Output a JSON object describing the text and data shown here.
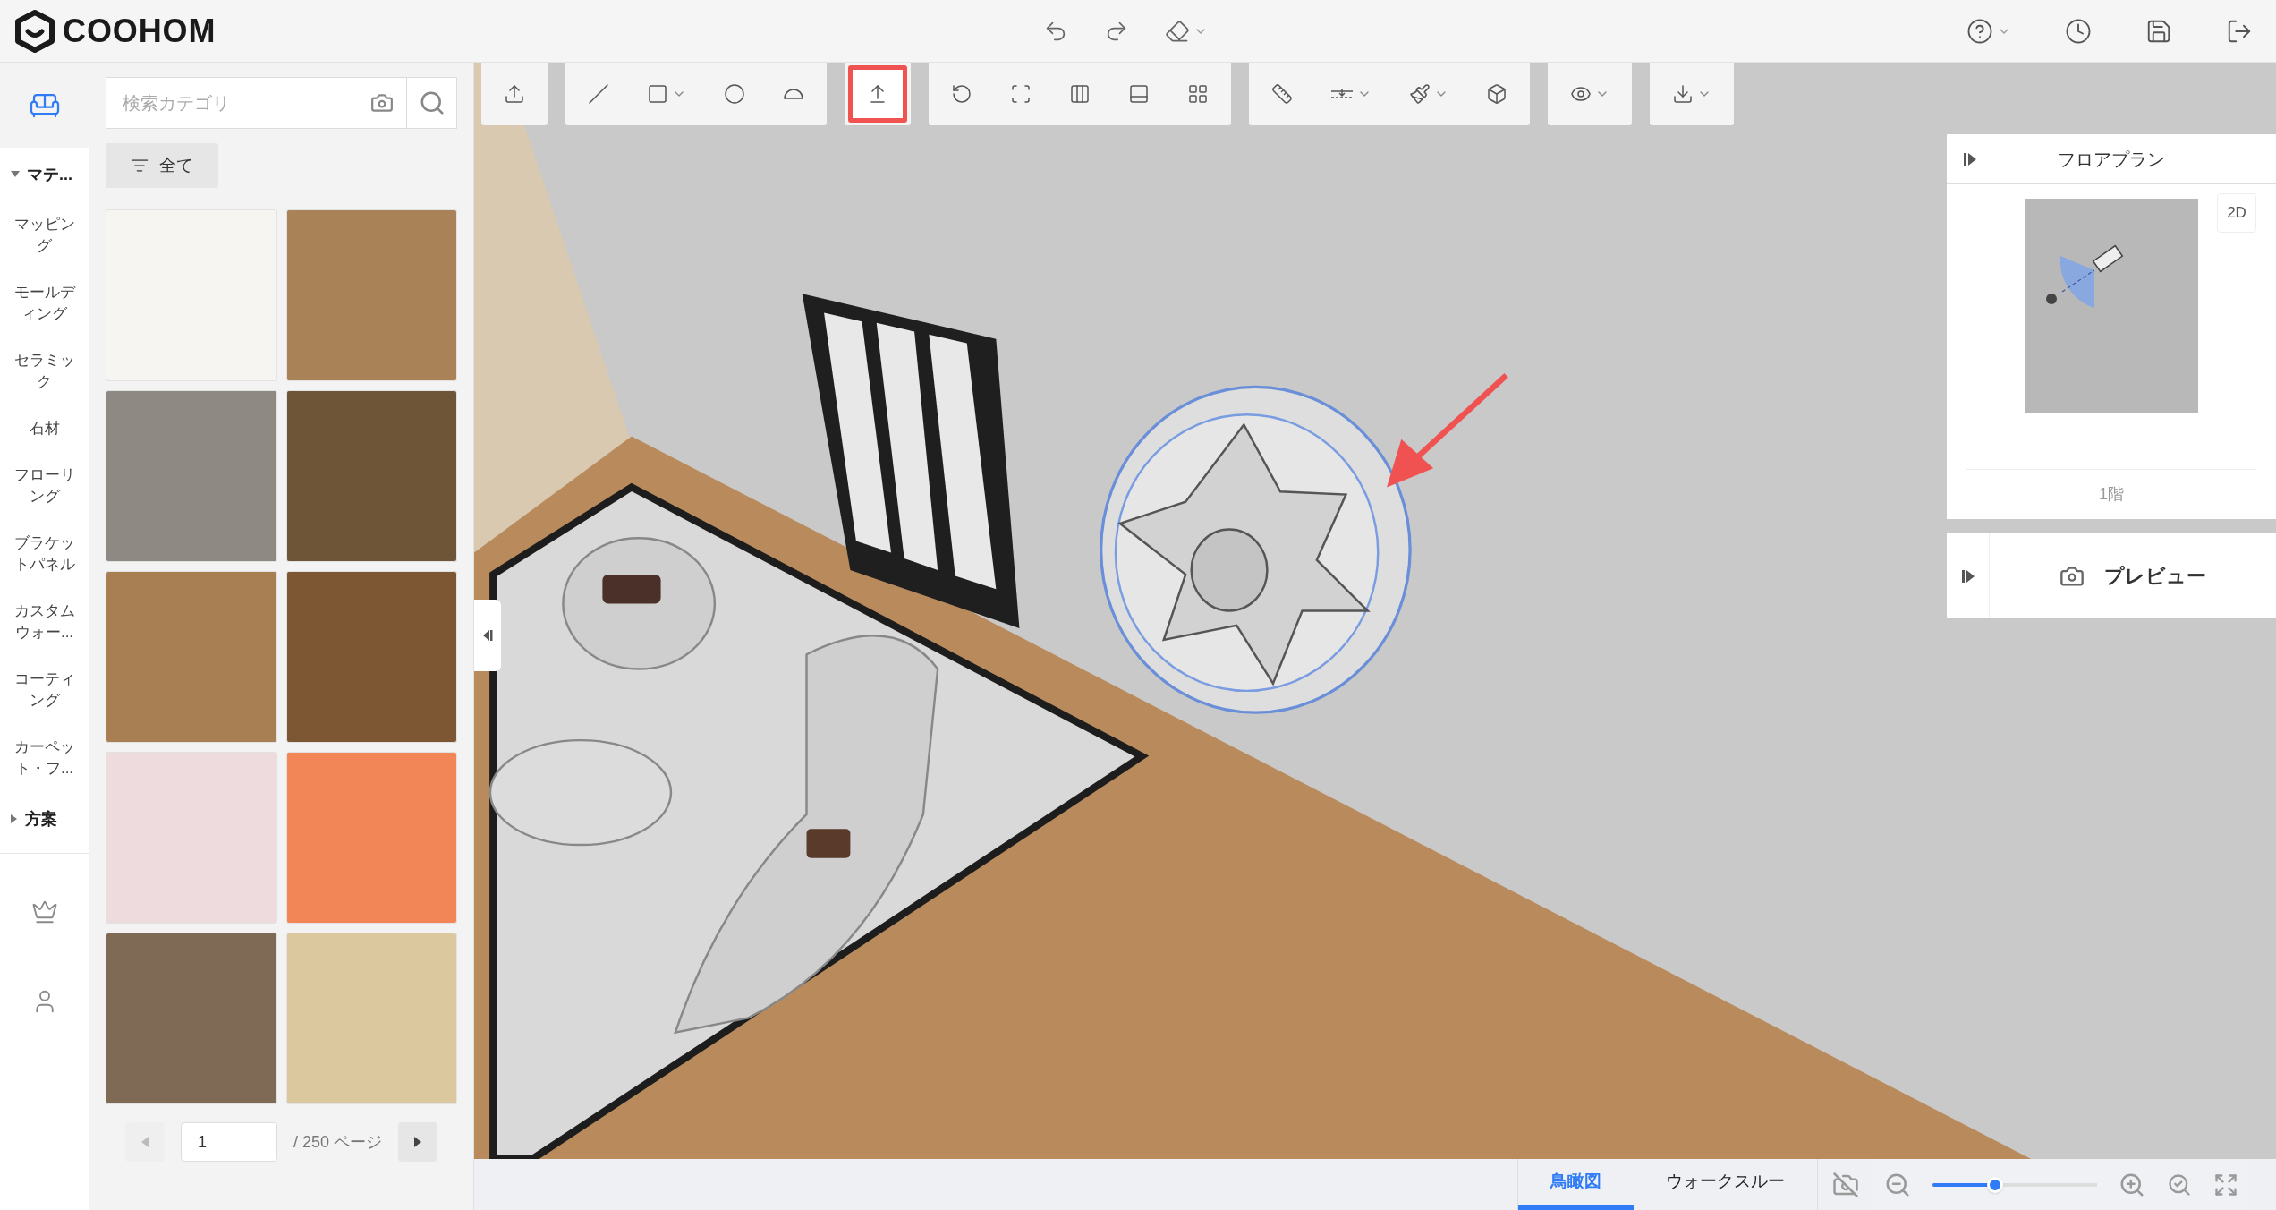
{
  "header": {
    "logo": "COOHOM",
    "actions": [
      {
        "kind": "undo",
        "dropdown": false
      },
      {
        "kind": "redo",
        "dropdown": false
      },
      {
        "kind": "eraser",
        "dropdown": true
      }
    ],
    "right_actions": [
      {
        "kind": "help",
        "dropdown": true
      },
      {
        "kind": "history",
        "dropdown": false
      },
      {
        "kind": "save",
        "dropdown": false
      },
      {
        "kind": "exit",
        "dropdown": false
      }
    ]
  },
  "rail": {
    "top_icon": {
      "kind": "sofa",
      "selected": true
    },
    "bottom_icons": [
      {
        "kind": "crown"
      },
      {
        "kind": "user"
      }
    ]
  },
  "categories": [
    {
      "label": "マテ...",
      "expanded": true,
      "children": [
        {
          "label": "マッピング"
        },
        {
          "label": "モールディング"
        },
        {
          "label": "セラミック"
        },
        {
          "label": "石材"
        },
        {
          "label": "フローリング"
        },
        {
          "label": "ブラケットパネル"
        },
        {
          "label": "カスタムウォー..."
        },
        {
          "label": "コーティング"
        },
        {
          "label": "カーペット・フ..."
        }
      ]
    },
    {
      "label": "方案",
      "expanded": false
    }
  ],
  "search": {
    "placeholder": "検索カテゴリ"
  },
  "filter": {
    "label": "全て"
  },
  "swatches": [
    {
      "color": "#f6f5f2"
    },
    {
      "color": "#a98258"
    },
    {
      "color": "#8f8984"
    },
    {
      "color": "#6f5538"
    },
    {
      "color": "#a77f52"
    },
    {
      "color": "#7d5733"
    },
    {
      "color": "#eddbdd"
    },
    {
      "color": "#f38657"
    },
    {
      "color": "#7f6a55"
    },
    {
      "color": "#dcc89e"
    }
  ],
  "pagination": {
    "page": "1",
    "total": "/ 250 ページ"
  },
  "toolbar": [
    {
      "tools": [
        {
          "kind": "upload",
          "selected": false,
          "dropdown": false
        }
      ]
    },
    {
      "tools": [
        {
          "kind": "line",
          "selected": false,
          "dropdown": false
        },
        {
          "kind": "rectangle",
          "selected": false,
          "dropdown": true
        },
        {
          "kind": "circle",
          "selected": false,
          "dropdown": false
        },
        {
          "kind": "arc",
          "selected": false,
          "dropdown": false
        }
      ]
    },
    {
      "tools": [
        {
          "kind": "lift",
          "selected": true,
          "dropdown": false
        }
      ]
    },
    {
      "tools": [
        {
          "kind": "rotate",
          "selected": false,
          "dropdown": false
        },
        {
          "kind": "frame",
          "selected": false,
          "dropdown": false
        },
        {
          "kind": "lines",
          "selected": false,
          "dropdown": false
        },
        {
          "kind": "panel",
          "selected": false,
          "dropdown": false
        },
        {
          "kind": "split",
          "selected": false,
          "dropdown": false
        }
      ]
    },
    {
      "tools": [
        {
          "kind": "tape",
          "selected": false,
          "dropdown": false
        },
        {
          "kind": "level",
          "selected": false,
          "dropdown": true
        },
        {
          "kind": "brush",
          "selected": false,
          "dropdown": true
        },
        {
          "kind": "cube",
          "selected": false,
          "dropdown": false
        }
      ]
    },
    {
      "tools": [
        {
          "kind": "eye",
          "selected": false,
          "dropdown": true
        }
      ]
    },
    {
      "tools": [
        {
          "kind": "download",
          "selected": false,
          "dropdown": true
        }
      ]
    }
  ],
  "floor_plan": {
    "title": "フロアプラン",
    "mode_button": "2D",
    "floor": "1階"
  },
  "preview": {
    "label": "プレビュー"
  },
  "view_tabs": [
    {
      "label": "鳥瞰図",
      "selected": true
    },
    {
      "label": "ウォークスルー",
      "selected": false
    }
  ],
  "zoom": {
    "level": 0.38
  }
}
